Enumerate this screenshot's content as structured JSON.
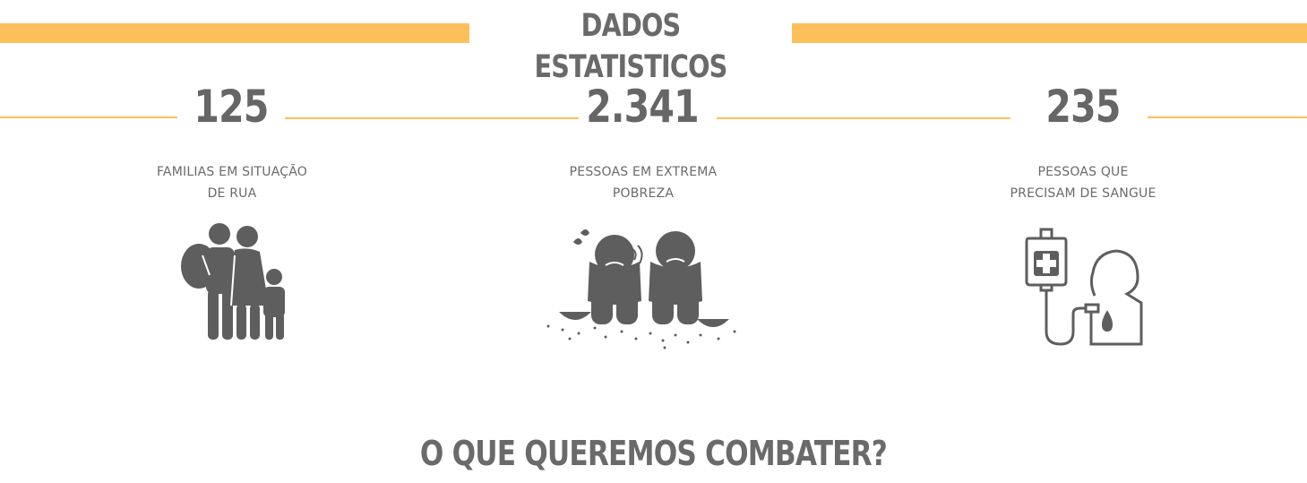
{
  "colors": {
    "accent": "#fdbf5a",
    "text": "#6a6a6a",
    "icon": "#5e5e5e"
  },
  "header": {
    "title": "DADOS ESTATISTICOS"
  },
  "stats": [
    {
      "value": "125",
      "caption_line1": "FAMILIAS EM SITUAÇÃO",
      "caption_line2": "DE RUA",
      "icon": "homeless-family-icon"
    },
    {
      "value": "2.341",
      "caption_line1": "PESSOAS EM EXTREMA",
      "caption_line2": "POBREZA",
      "icon": "poverty-people-icon"
    },
    {
      "value": "235",
      "caption_line1": "PESSOAS QUE",
      "caption_line2": "PRECISAM DE SANGUE",
      "icon": "blood-transfusion-icon"
    }
  ],
  "footer": {
    "title": "O QUE QUEREMOS COMBATER?"
  }
}
